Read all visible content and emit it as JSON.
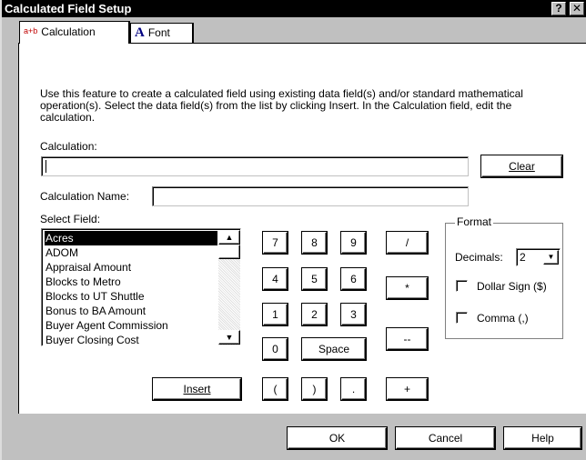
{
  "window": {
    "title": "Calculated Field Setup",
    "help_glyph": "?",
    "close_glyph": "✕"
  },
  "tabs": [
    {
      "icon": "a+b",
      "label": "Calculation",
      "active": true
    },
    {
      "icon": "A",
      "label": "Font",
      "active": false
    }
  ],
  "description": "Use this feature to create a calculated field using existing data field(s) and/or standard mathematical operation(s).  Select the data field(s) from the list by clicking Insert.  In the Calculation field, edit the calculation.",
  "calculation": {
    "label": "Calculation:",
    "value": "",
    "clear_button": "Clear"
  },
  "calculation_name": {
    "label": "Calculation Name:",
    "value": ""
  },
  "select_field": {
    "label": "Select Field:",
    "items": [
      "Acres",
      "ADOM",
      "Appraisal Amount",
      "Blocks to Metro",
      "Blocks to UT Shuttle",
      "Bonus to BA Amount",
      "Buyer Agent Commission",
      "Buyer Closing Cost"
    ],
    "selected": "Acres",
    "insert_button": "Insert"
  },
  "keypad": {
    "digits_row1": [
      "7",
      "8",
      "9"
    ],
    "digits_row2": [
      "4",
      "5",
      "6"
    ],
    "digits_row3": [
      "1",
      "2",
      "3"
    ],
    "zero": "0",
    "space": "Space",
    "divide": "/",
    "multiply": "*",
    "minus": "--",
    "plus": "+",
    "open_paren": "(",
    "close_paren": ")",
    "dot": "."
  },
  "format": {
    "caption": "Format",
    "decimals_label": "Decimals:",
    "decimals_value": "2",
    "dollar_sign_label": "Dollar Sign ($)",
    "dollar_sign_checked": false,
    "comma_label": "Comma (,)",
    "comma_checked": false
  },
  "footer": {
    "ok": "OK",
    "cancel": "Cancel",
    "help": "Help"
  }
}
